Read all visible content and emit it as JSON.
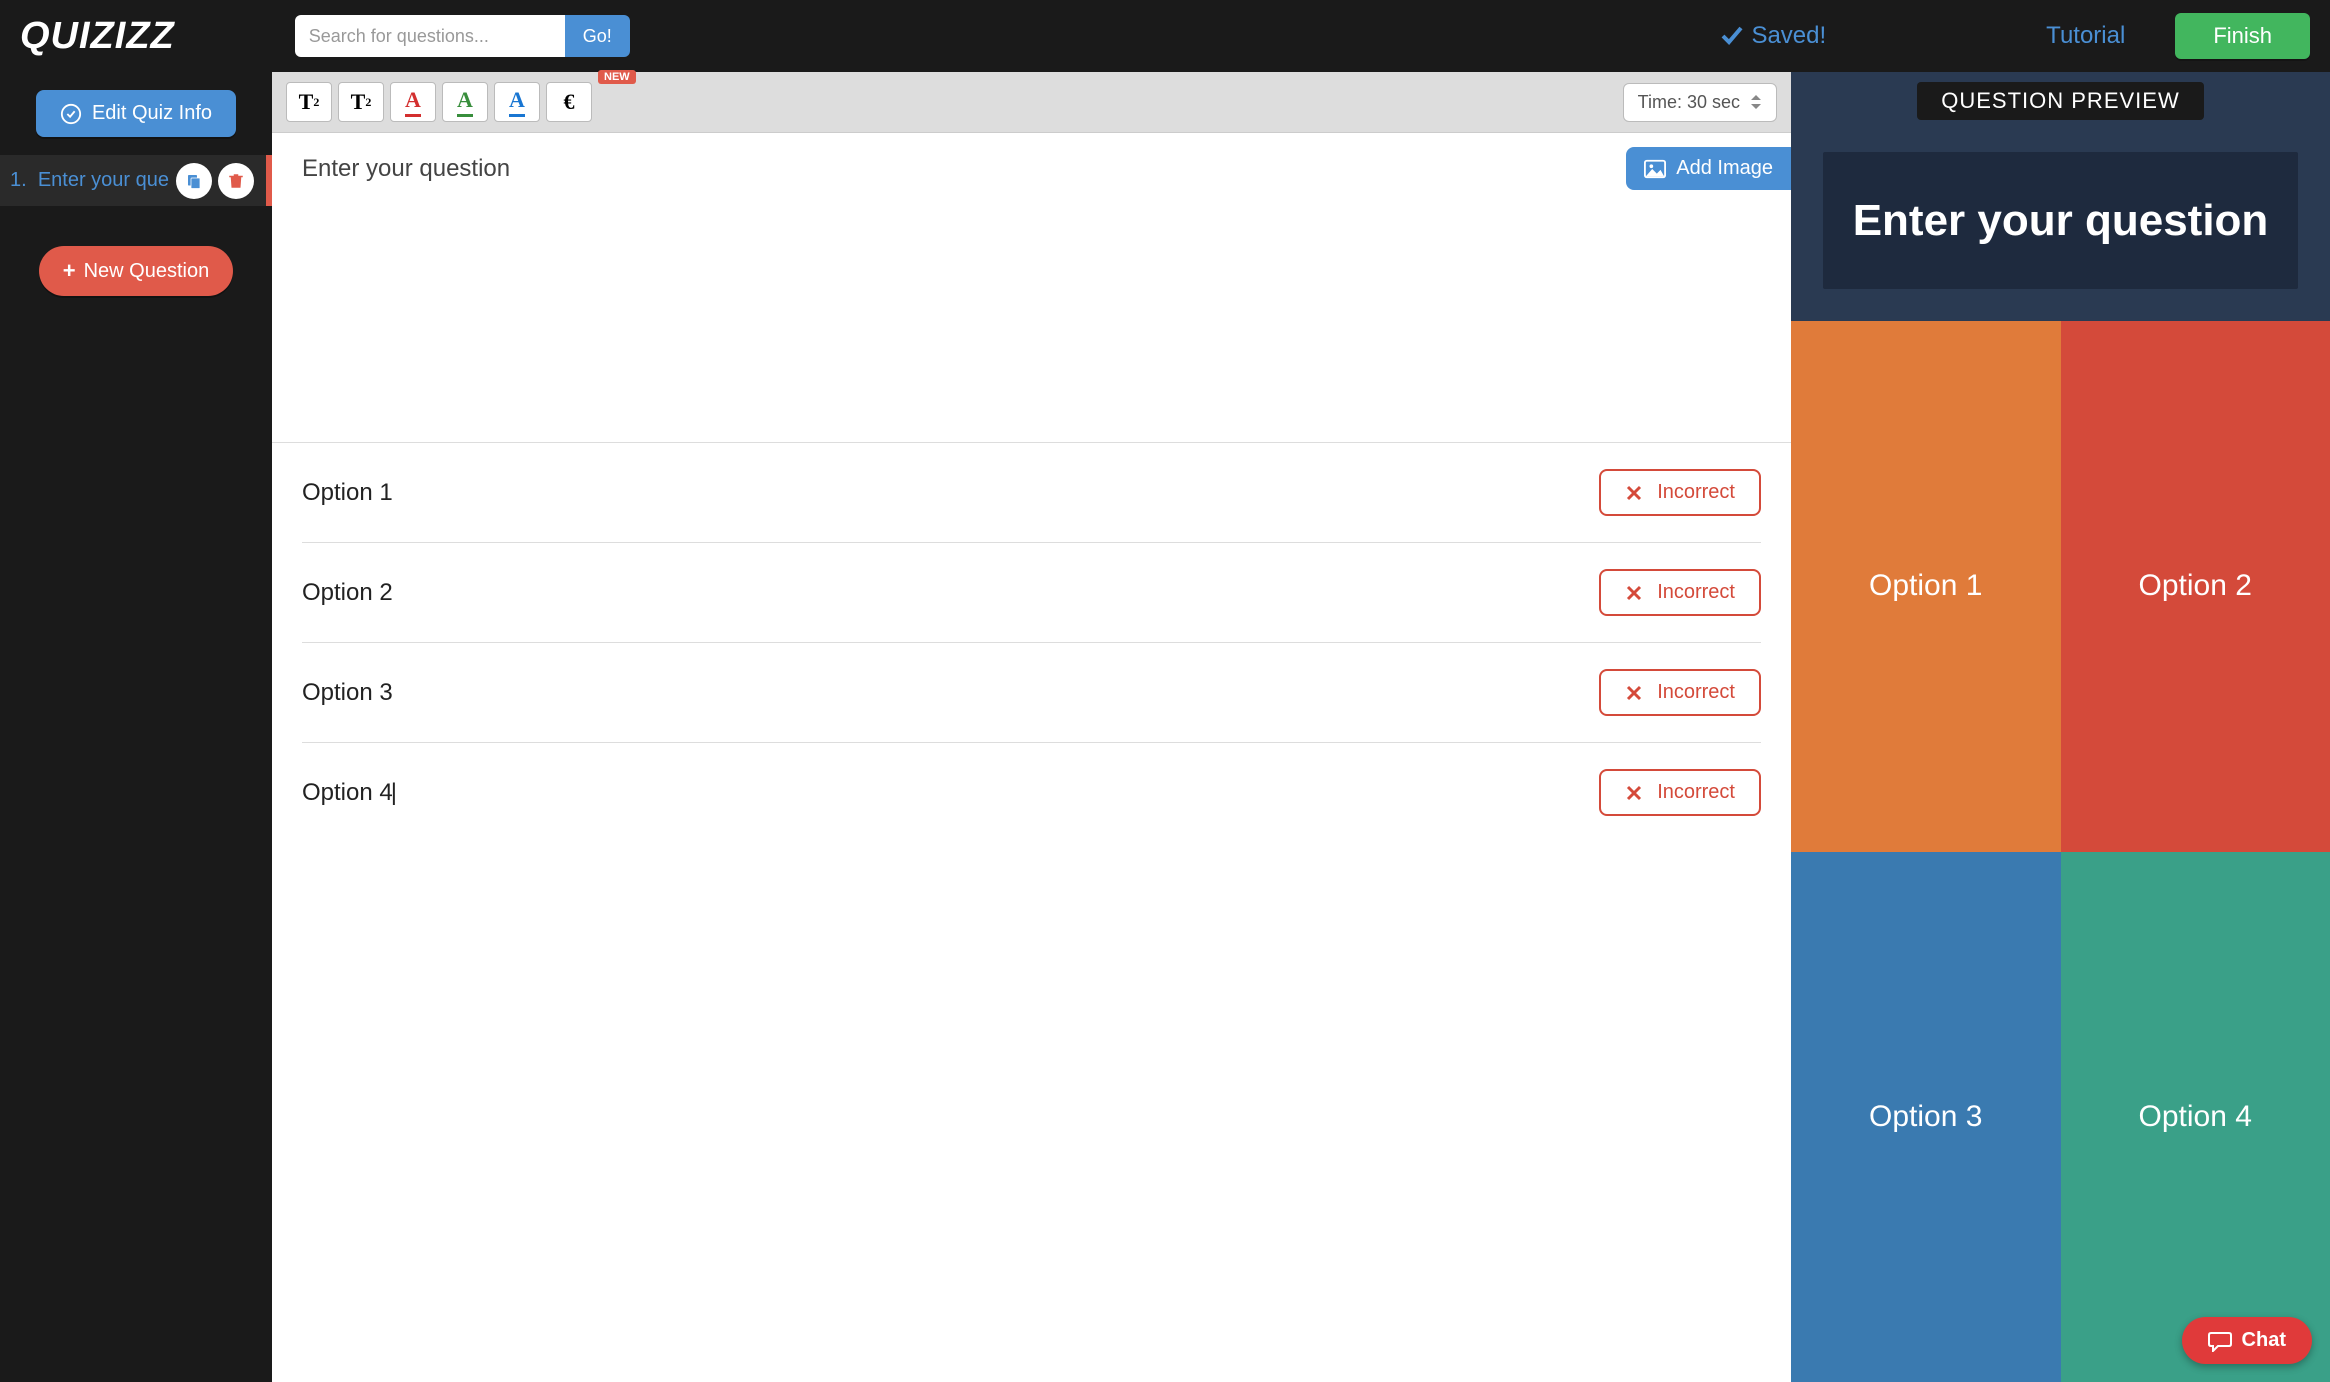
{
  "header": {
    "logo": "QUIZIZZ",
    "search_placeholder": "Search for questions...",
    "go_label": "Go!",
    "saved_label": "Saved!",
    "tutorial_label": "Tutorial",
    "finish_label": "Finish"
  },
  "sidebar": {
    "edit_info_label": "Edit Quiz Info",
    "question_item": {
      "number": "1.",
      "text": "Enter your que"
    },
    "new_question_label": "New Question"
  },
  "toolbar": {
    "superscript": "T",
    "subscript": "T",
    "red_a": "A",
    "green_a": "A",
    "blue_a": "A",
    "euro": "€",
    "new_badge": "NEW",
    "time_label": "Time: 30 sec"
  },
  "editor": {
    "question_placeholder": "Enter your question",
    "add_image_label": "Add Image",
    "options": [
      {
        "label": "Option 1",
        "status": "Incorrect"
      },
      {
        "label": "Option 2",
        "status": "Incorrect"
      },
      {
        "label": "Option 3",
        "status": "Incorrect"
      },
      {
        "label": "Option 4",
        "status": "Incorrect"
      }
    ]
  },
  "preview": {
    "title": "QUESTION PREVIEW",
    "question": "Enter your question",
    "cells": [
      {
        "label": "Option 1",
        "color": "orange"
      },
      {
        "label": "Option 2",
        "color": "red"
      },
      {
        "label": "Option 3",
        "color": "blue"
      },
      {
        "label": "Option 4",
        "color": "teal"
      }
    ]
  },
  "chat_label": "Chat"
}
